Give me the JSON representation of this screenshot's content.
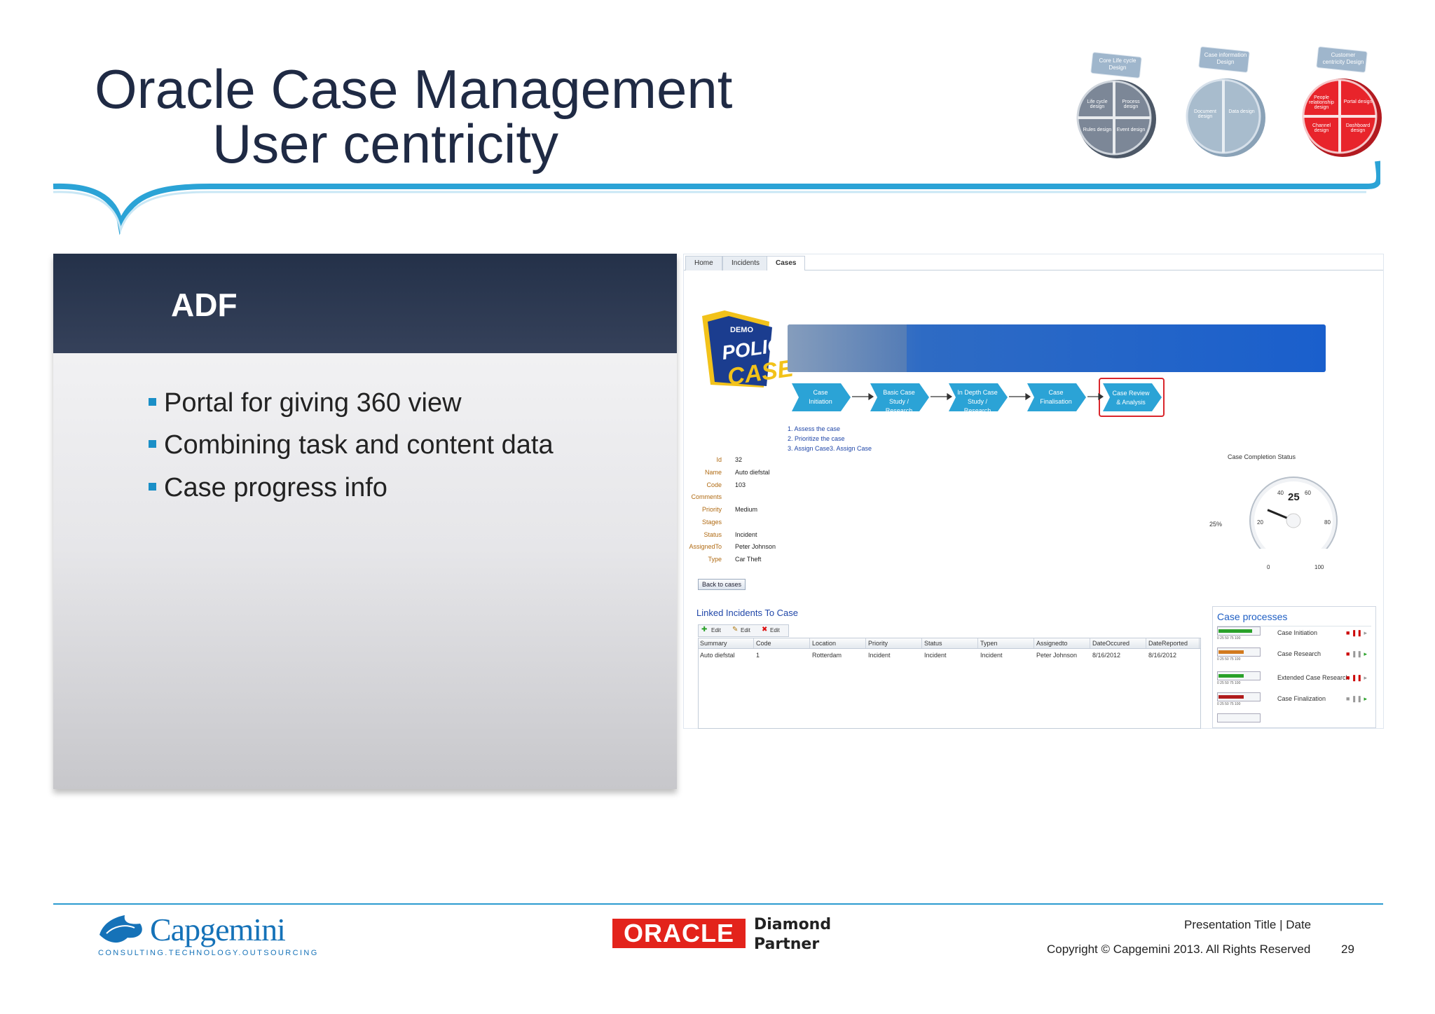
{
  "slide": {
    "title_line1": "Oracle Case Management",
    "title_line2": "User centricity"
  },
  "header_graphics": {
    "circle1": {
      "tab": "Core Life cycle Design",
      "segments": [
        "Life cycle design",
        "Process design",
        "Rules design",
        "Event design"
      ],
      "color": "#7c8797"
    },
    "circle2": {
      "tab": "Case information Design",
      "segments": [
        "Document design",
        "Data design"
      ],
      "color": "#a8bccd"
    },
    "circle3": {
      "tab": "Customer centricity Design",
      "segments": [
        "People relationship design",
        "Portal design",
        "Channel design",
        "Dashboard design"
      ],
      "color": "#e8242b"
    }
  },
  "adf_panel": {
    "heading": "ADF",
    "bullets": [
      "Portal for giving 360 view",
      "Combining task and content data",
      "Case progress info"
    ]
  },
  "app": {
    "tabs": [
      "Home",
      "Incidents",
      "Cases"
    ],
    "active_tab": "Cases",
    "logo": {
      "top": "DEMO",
      "line1": "POLICE",
      "line2": "CASE"
    },
    "steps": [
      {
        "line1": "Case",
        "line2": "Initiation"
      },
      {
        "line1": "Basic Case",
        "line2": "Study / Research"
      },
      {
        "line1": "In Depth Case",
        "line2": "Study / Research"
      },
      {
        "line1": "Case",
        "line2": "Finalisation"
      },
      {
        "line1": "Case Review",
        "line2": "& Analysis"
      }
    ],
    "tasks": [
      "1. Assess the case",
      "2. Prioritize the case",
      "3. Assign Case3. Assign Case"
    ],
    "fields": [
      {
        "label": "Id",
        "value": "32"
      },
      {
        "label": "Name",
        "value": "Auto diefstal"
      },
      {
        "label": "Code",
        "value": "103"
      },
      {
        "label": "Comments",
        "value": ""
      },
      {
        "label": "Priority",
        "value": "Medium"
      },
      {
        "label": "Stages",
        "value": ""
      },
      {
        "label": "Status",
        "value": "Incident"
      },
      {
        "label": "AssignedTo",
        "value": "Peter Johnson"
      },
      {
        "label": "Type",
        "value": "Car Theft"
      }
    ],
    "back_button": "Back to cases",
    "gauge": {
      "title": "Case Completion Status",
      "value": 25,
      "value_label": "25",
      "percent_label": "25%",
      "ticks": [
        "0",
        "20",
        "40",
        "60",
        "80",
        "100"
      ]
    },
    "linked": {
      "title": "Linked Incidents To Case",
      "buttons": [
        "Edit",
        "Edit",
        "Edit"
      ],
      "columns": [
        "Summary",
        "Code",
        "Location",
        "Priority",
        "Status",
        "Typen",
        "Assignedto",
        "DateOccured",
        "DateReported"
      ],
      "rows": [
        [
          "Auto diefstal",
          "1",
          "Rotterdam",
          "Incident",
          "Incident",
          "Incident",
          "Peter Johnson",
          "8/16/2012",
          "8/16/2012"
        ]
      ]
    },
    "processes": {
      "title": "Case processes",
      "ticks": "0    25    50    75   100",
      "items": [
        {
          "name": "Case Initiation",
          "progress": 0.85,
          "color": "#2aa12a"
        },
        {
          "name": "Case Research",
          "progress": 0.65,
          "color": "#d27a1e"
        },
        {
          "name": "Extended Case Research",
          "progress": 0.65,
          "color": "#2aa12a"
        },
        {
          "name": "Case Finalization",
          "progress": 0.65,
          "color": "#b01c1c"
        }
      ]
    }
  },
  "footer": {
    "capgemini_name": "Capgemini",
    "capgemini_tagline": "CONSULTING.TECHNOLOGY.OUTSOURCING",
    "oracle_logo": "ORACLE",
    "partner_line1": "Diamond",
    "partner_line2": "Partner",
    "presentation": "Presentation Title | Date",
    "copyright": "Copyright © Capgemini 2013. All Rights Reserved",
    "page_number": "29"
  }
}
